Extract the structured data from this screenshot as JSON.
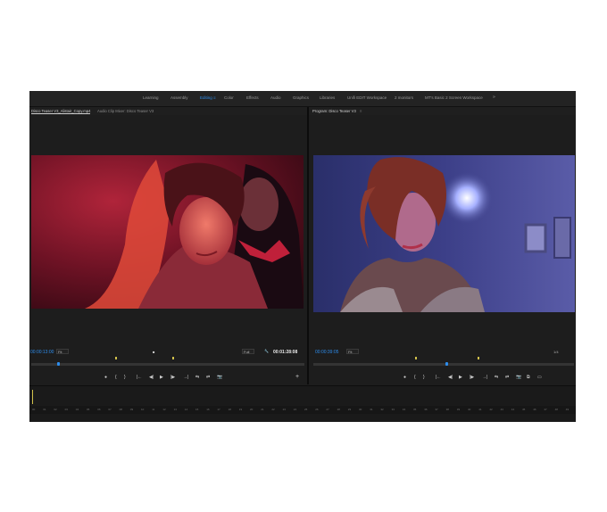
{
  "workspaces": [
    {
      "label": "Learning",
      "active": false
    },
    {
      "label": "Assembly",
      "active": false
    },
    {
      "label": "Editing",
      "active": true
    },
    {
      "label": "Color",
      "active": false
    },
    {
      "label": "Effects",
      "active": false
    },
    {
      "label": "Audio",
      "active": false
    },
    {
      "label": "Graphics",
      "active": false
    },
    {
      "label": "Libraries",
      "active": false
    },
    {
      "label": "Unifi EDIT Workspace",
      "active": false
    },
    {
      "label": "2 monitors",
      "active": false
    },
    {
      "label": "MT's Basic 2 Screen Workspace",
      "active": false
    }
  ],
  "workspaces_more": "»",
  "editing_menu_icon": "≡",
  "source": {
    "tab_active": "Disco Teaser V3_Alistair_Copy.mp4",
    "tab_menu": "≡",
    "tab_other": "Audio Clip Mixer: Disco Teaser V3",
    "timecode": "00:00:13:00",
    "fit": "Fit",
    "duration": "00:01:28:08",
    "resolution": "Full",
    "icon_name": "wrench-icon"
  },
  "program": {
    "tab": "Program: Disco Teaser V3",
    "tab_menu": "≡",
    "timecode": "00:00:39:05",
    "fit": "Fit",
    "resolution": "1/4"
  },
  "source_controls": [
    "●",
    "{",
    "}",
    "|←",
    "◀|",
    "▶",
    "|▶",
    "→|",
    "⇆",
    "⇄",
    "📷"
  ],
  "program_controls": [
    "●",
    "{",
    "}",
    "|←",
    "◀|",
    "▶",
    "|▶",
    "→|",
    "⇆",
    "⇄",
    "📷",
    "⧉",
    "▭"
  ],
  "source_add": "+",
  "timeline_numbers": [
    "00",
    "01",
    "02",
    "03",
    "04",
    "05",
    "06",
    "07",
    "08",
    "09",
    "10",
    "11",
    "12",
    "13",
    "14",
    "15",
    "16",
    "17",
    "18",
    "19",
    "20",
    "21",
    "22",
    "23",
    "24",
    "25",
    "26",
    "27",
    "28",
    "29",
    "30",
    "31",
    "32",
    "33",
    "34",
    "35",
    "36",
    "37",
    "38",
    "39",
    "40",
    "41",
    "42",
    "43",
    "44",
    "45",
    "46",
    "47",
    "48",
    "49"
  ],
  "colors": {
    "accent": "#2d8ceb",
    "marker": "#d2c14b",
    "bg": "#1d1d1d"
  }
}
